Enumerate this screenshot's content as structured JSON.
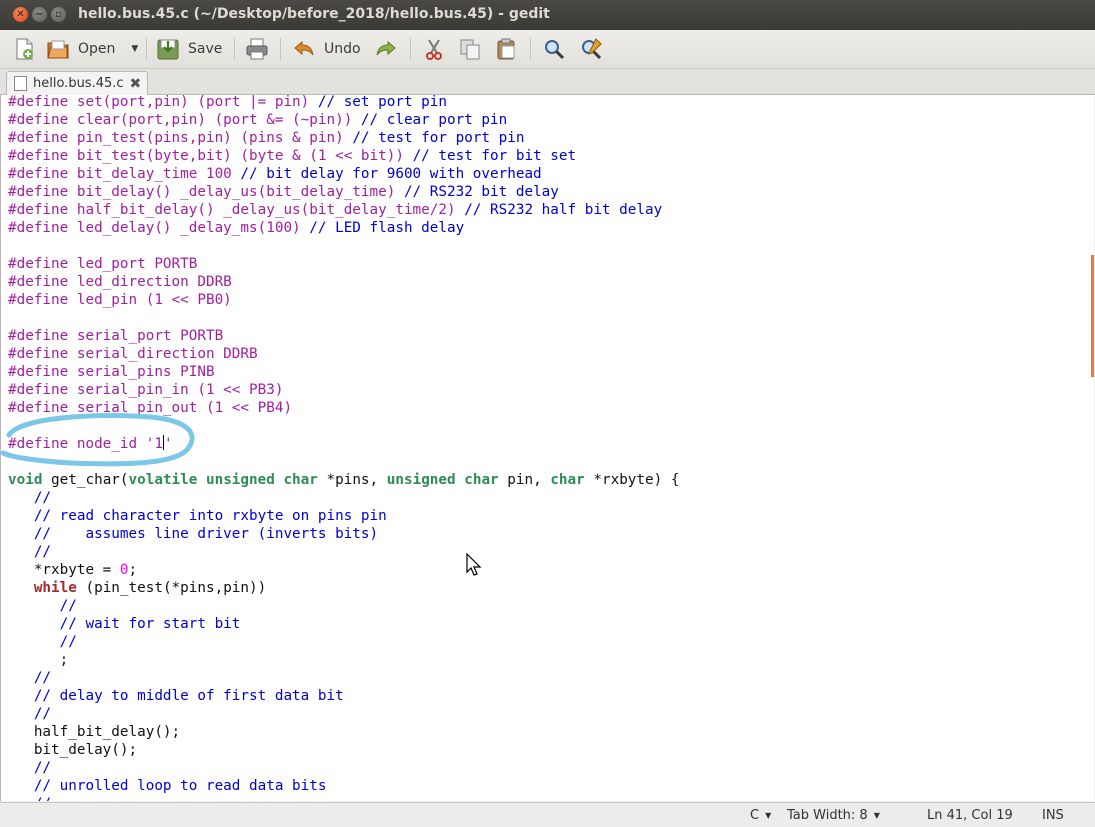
{
  "window": {
    "title": "hello.bus.45.c (~/Desktop/before_2018/hello.bus.45) - gedit"
  },
  "toolbar": {
    "open_label": "Open",
    "save_label": "Save",
    "undo_label": "Undo"
  },
  "tab": {
    "label": "hello.bus.45.c"
  },
  "status": {
    "language": "C",
    "tab_width": "Tab Width:  8",
    "position": "Ln 41, Col 19",
    "mode": "INS"
  },
  "code_lines": [
    [
      [
        "pp",
        "#define set(port,pin) (port |= pin) "
      ],
      [
        "cm",
        "// set port pin"
      ]
    ],
    [
      [
        "pp",
        "#define clear(port,pin) (port &= (~pin)) "
      ],
      [
        "cm",
        "// clear port pin"
      ]
    ],
    [
      [
        "pp",
        "#define pin_test(pins,pin) (pins & pin) "
      ],
      [
        "cm",
        "// test for port pin"
      ]
    ],
    [
      [
        "pp",
        "#define bit_test(byte,bit) (byte & (1 << bit)) "
      ],
      [
        "cm",
        "// test for bit set"
      ]
    ],
    [
      [
        "pp",
        "#define bit_delay_time 100 "
      ],
      [
        "cm",
        "// bit delay for 9600 with overhead"
      ]
    ],
    [
      [
        "pp",
        "#define bit_delay() _delay_us(bit_delay_time) "
      ],
      [
        "cm",
        "// RS232 bit delay"
      ]
    ],
    [
      [
        "pp",
        "#define half_bit_delay() _delay_us(bit_delay_time/2) "
      ],
      [
        "cm",
        "// RS232 half bit delay"
      ]
    ],
    [
      [
        "pp",
        "#define led_delay() _delay_ms(100) "
      ],
      [
        "cm",
        "// LED flash delay"
      ]
    ],
    [],
    [
      [
        "pp",
        "#define led_port PORTB"
      ]
    ],
    [
      [
        "pp",
        "#define led_direction DDRB"
      ]
    ],
    [
      [
        "pp",
        "#define led_pin (1 << PB0)"
      ]
    ],
    [],
    [
      [
        "pp",
        "#define serial_port PORTB"
      ]
    ],
    [
      [
        "pp",
        "#define serial_direction DDRB"
      ]
    ],
    [
      [
        "pp",
        "#define serial_pins PINB"
      ]
    ],
    [
      [
        "pp",
        "#define serial_pin_in (1 << PB3)"
      ]
    ],
    [
      [
        "pp",
        "#define serial_pin_out (1 << PB4)"
      ]
    ],
    [],
    [
      [
        "pp",
        "#define node_id '1"
      ],
      [
        "caret",
        ""
      ],
      [
        "pp",
        "'"
      ]
    ],
    [],
    [
      [
        "ty",
        "void"
      ],
      [
        "tx",
        " get_char("
      ],
      [
        "ty",
        "volatile unsigned char"
      ],
      [
        "tx",
        " *pins, "
      ],
      [
        "ty",
        "unsigned char"
      ],
      [
        "tx",
        " pin, "
      ],
      [
        "ty",
        "char"
      ],
      [
        "tx",
        " *rxbyte) {"
      ]
    ],
    [
      [
        "cm",
        "   //"
      ]
    ],
    [
      [
        "cm",
        "   // read character into rxbyte on pins pin"
      ]
    ],
    [
      [
        "cm",
        "   //    assumes line driver (inverts bits)"
      ]
    ],
    [
      [
        "cm",
        "   //"
      ]
    ],
    [
      [
        "tx",
        "   *rxbyte = "
      ],
      [
        "num",
        "0"
      ],
      [
        "tx",
        ";"
      ]
    ],
    [
      [
        "kw",
        "   while"
      ],
      [
        "tx",
        " (pin_test(*pins,pin))"
      ]
    ],
    [
      [
        "cm",
        "      //"
      ]
    ],
    [
      [
        "cm",
        "      // wait for start bit"
      ]
    ],
    [
      [
        "cm",
        "      //"
      ]
    ],
    [
      [
        "tx",
        "      ;"
      ]
    ],
    [
      [
        "cm",
        "   //"
      ]
    ],
    [
      [
        "cm",
        "   // delay to middle of first data bit"
      ]
    ],
    [
      [
        "cm",
        "   //"
      ]
    ],
    [
      [
        "tx",
        "   half_bit_delay();"
      ]
    ],
    [
      [
        "tx",
        "   bit_delay();"
      ]
    ],
    [
      [
        "cm",
        "   //"
      ]
    ],
    [
      [
        "cm",
        "   // unrolled loop to read data bits"
      ]
    ],
    [
      [
        "cm",
        "   //"
      ]
    ]
  ]
}
